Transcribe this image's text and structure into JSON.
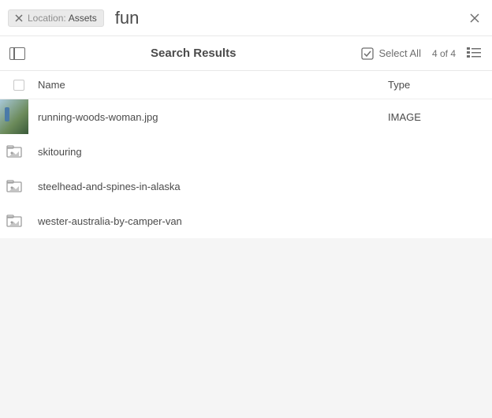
{
  "search": {
    "chip_label": "Location:",
    "chip_value": "Assets",
    "query": "fun"
  },
  "toolbar": {
    "title": "Search Results",
    "select_all": "Select All",
    "count": "4 of 4"
  },
  "columns": {
    "name": "Name",
    "type": "Type"
  },
  "rows": [
    {
      "name": "running-woods-woman.jpg",
      "type": "IMAGE",
      "thumb": "image"
    },
    {
      "name": "skitouring",
      "type": "",
      "thumb": "folder"
    },
    {
      "name": "steelhead-and-spines-in-alaska",
      "type": "",
      "thumb": "folder"
    },
    {
      "name": "wester-australia-by-camper-van",
      "type": "",
      "thumb": "folder"
    }
  ]
}
